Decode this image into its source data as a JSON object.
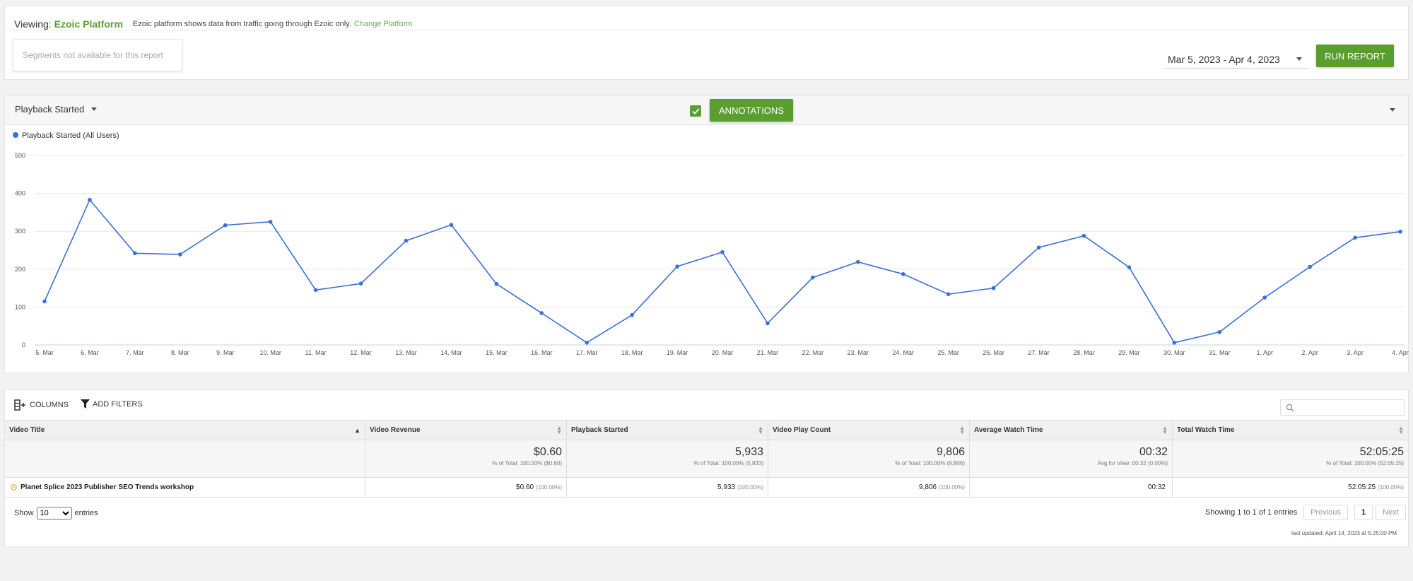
{
  "header": {
    "viewing_label": "Viewing:",
    "platform": "Ezoic Platform",
    "note": "Ezoic platform shows data from traffic going through Ezoic only.",
    "change_link": "Change Platform",
    "segments_placeholder": "Segments not available for this report",
    "date_range": "Mar 5, 2023 - Apr 4, 2023",
    "run_report": "RUN REPORT"
  },
  "chart_panel": {
    "metric": "Playback Started",
    "annotations_label": "ANNOTATIONS",
    "annotations_checked": true
  },
  "chart_data": {
    "type": "line",
    "legend": "Playback Started (All Users)",
    "legend_position": "top-left",
    "color": "#3a70d4",
    "ylim": [
      0,
      500
    ],
    "yticks": [
      0,
      100,
      200,
      300,
      400,
      500
    ],
    "grid": true,
    "x": [
      "5. Mar",
      "6. Mar",
      "7. Mar",
      "8. Mar",
      "9. Mar",
      "10. Mar",
      "11. Mar",
      "12. Mar",
      "13. Mar",
      "14. Mar",
      "15. Mar",
      "16. Mar",
      "17. Mar",
      "18. Mar",
      "19. Mar",
      "20. Mar",
      "21. Mar",
      "22. Mar",
      "23. Mar",
      "24. Mar",
      "25. Mar",
      "26. Mar",
      "27. Mar",
      "28. Mar",
      "29. Mar",
      "30. Mar",
      "31. Mar",
      "1. Apr",
      "2. Apr",
      "3. Apr",
      "4. Apr"
    ],
    "series": [
      {
        "name": "Playback Started (All Users)",
        "values": [
          115,
          383,
          242,
          239,
          316,
          325,
          145,
          162,
          275,
          317,
          161,
          84,
          6,
          79,
          207,
          245,
          57,
          178,
          219,
          187,
          134,
          150,
          257,
          288,
          205,
          6,
          34,
          125,
          206,
          283,
          299
        ]
      }
    ]
  },
  "table": {
    "columns_btn": "COLUMNS",
    "filters_btn": "ADD FILTERS",
    "headers": [
      "Video Title",
      "Video Revenue",
      "Playback Started",
      "Video Play Count",
      "Average Watch Time",
      "Total Watch Time"
    ],
    "totals": [
      {
        "value": "$0.60",
        "sub": "% of Total: 100.00% ($0.60)"
      },
      {
        "value": "5,933",
        "sub": "% of Total: 100.00% (5,933)"
      },
      {
        "value": "9,806",
        "sub": "% of Total: 100.00% (9,806)"
      },
      {
        "value": "00:32",
        "sub": "Avg for View: 00:32 (0.00%)"
      },
      {
        "value": "52:05:25",
        "sub": "% of Total: 100.00% (52:05:25)"
      }
    ],
    "row": {
      "title": "Planet Splice 2023 Publisher SEO Trends workshop",
      "cells": [
        {
          "value": "$0.60",
          "pct": "(100.00%)"
        },
        {
          "value": "5,933",
          "pct": "(100.00%)"
        },
        {
          "value": "9,806",
          "pct": "(100.00%)"
        },
        {
          "value": "00:32",
          "pct": ""
        },
        {
          "value": "52:05:25",
          "pct": "(100.00%)"
        }
      ]
    },
    "show_label": "Show",
    "page_size": "10",
    "entries_label": "entries",
    "showing": "Showing 1 to 1 of 1 entries",
    "previous": "Previous",
    "page": "1",
    "next": "Next",
    "last_updated": "last updated: April 14, 2023 at 5:25:00 PM"
  }
}
